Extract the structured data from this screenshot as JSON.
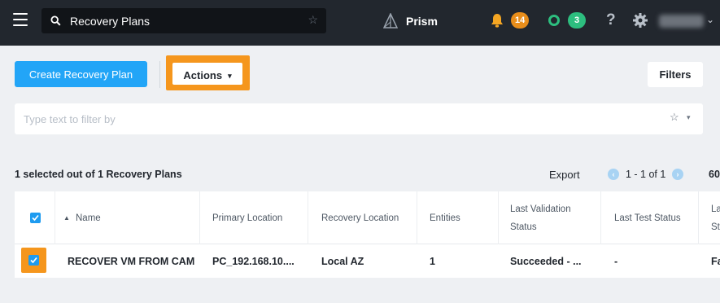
{
  "topbar": {
    "search_value": "Recovery Plans",
    "app_name": "Prism",
    "alerts_count": "14",
    "tasks_count": "3",
    "help_label": "?"
  },
  "toolbar": {
    "create_label": "Create Recovery Plan",
    "actions_label": "Actions",
    "filters_label": "Filters"
  },
  "filter": {
    "placeholder": "Type text to filter by"
  },
  "summary": {
    "selection_text": "1 selected out of 1 Recovery Plans",
    "export_label": "Export",
    "page_range": "1 - 1 of 1",
    "per_page": "60"
  },
  "table": {
    "headers": {
      "name": "Name",
      "primary_location": "Primary Location",
      "recovery_location": "Recovery Location",
      "entities": "Entities",
      "last_validation_status_1": "Last Validation",
      "last_validation_status_2": "Status",
      "last_test_status": "Last Test Status",
      "last_col_1": "La",
      "last_col_2": "St"
    },
    "rows": [
      {
        "name": "RECOVER VM FROM CAM",
        "primary_location": "PC_192.168.10....",
        "recovery_location": "Local AZ",
        "entities": "1",
        "last_validation_status": "Succeeded - ...",
        "last_test_status": "-",
        "last_col": "Fa"
      }
    ]
  },
  "colors": {
    "topbar_bg": "#22272e",
    "primary_blue": "#22a5f7",
    "highlight_orange": "#f5961d",
    "alert_badge": "#e98e1b",
    "task_badge": "#2dbe7f",
    "checkbox_blue": "#1e9bf0"
  },
  "icons": [
    "hamburger-icon",
    "search-icon",
    "star-icon",
    "prism-logo-icon",
    "bell-icon",
    "tasks-ring-icon",
    "help-icon",
    "gear-icon",
    "chevron-down-icon",
    "chevron-left-icon",
    "chevron-right-icon",
    "checkbox-checked-icon",
    "sort-asc-icon"
  ]
}
